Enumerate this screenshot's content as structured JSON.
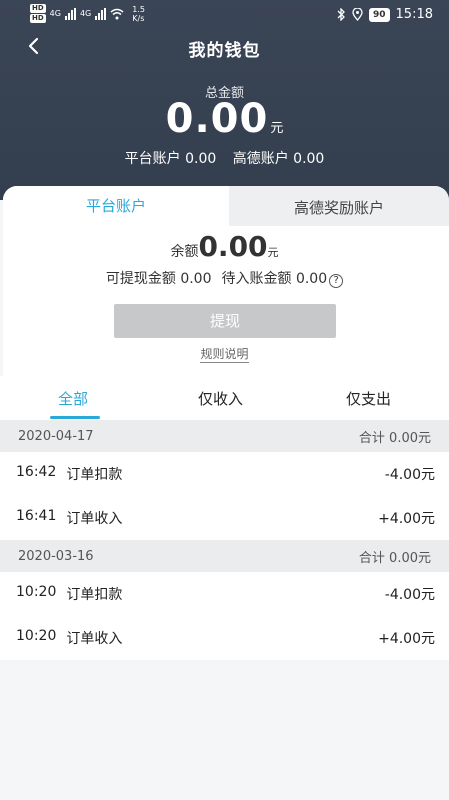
{
  "status_bar": {
    "hd_top": "HD",
    "hd_bottom": "HD",
    "net_signal_1": "4G",
    "net_signal_2": "4G",
    "speed_value": "1.5",
    "speed_unit": "K/s",
    "battery": "90",
    "time": "15:18"
  },
  "nav": {
    "title": "我的钱包"
  },
  "summary": {
    "total_label": "总金额",
    "total_amount": "0.00",
    "total_unit": "元",
    "platform_account": "平台账户 0.00",
    "gaode_account": "高德账户 0.00"
  },
  "tabs": {
    "platform": "平台账户",
    "gaode_reward": "高德奖励账户"
  },
  "balance": {
    "label": "余额",
    "amount": "0.00",
    "unit": "元",
    "withdrawable": "可提现金额 0.00",
    "pending": "待入账金额 0.00",
    "help_glyph": "?"
  },
  "actions": {
    "withdraw": "提现",
    "rules": "规则说明"
  },
  "filters": {
    "all": "全部",
    "income_only": "仅收入",
    "expense_only": "仅支出"
  },
  "transactions": [
    {
      "date": "2020-04-17",
      "total": "合计 0.00元",
      "items": [
        {
          "time": "16:42",
          "desc": "订单扣款",
          "amount": "-4.00元"
        },
        {
          "time": "16:41",
          "desc": "订单收入",
          "amount": "+4.00元"
        }
      ]
    },
    {
      "date": "2020-03-16",
      "total": "合计 0.00元",
      "items": [
        {
          "time": "10:20",
          "desc": "订单扣款",
          "amount": "-4.00元"
        },
        {
          "time": "10:20",
          "desc": "订单收入",
          "amount": "+4.00元"
        }
      ]
    }
  ]
}
